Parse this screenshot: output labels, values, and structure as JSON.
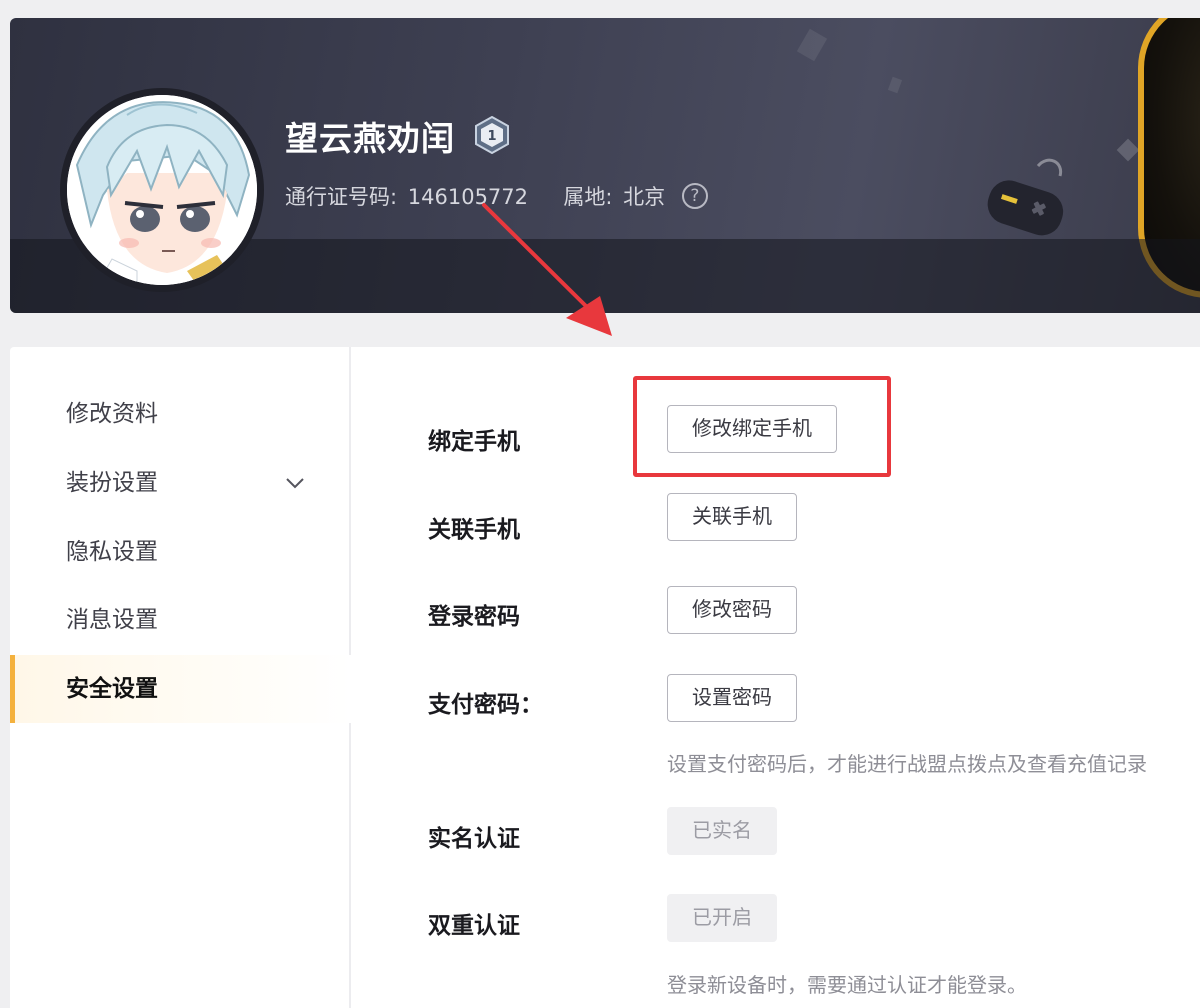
{
  "profile": {
    "username": "望云燕劝闰",
    "level": "1",
    "pass_id_label": "通行证号码:",
    "pass_id_value": "146105772",
    "location_label": "属地:",
    "location_value": "北京",
    "help_glyph": "?"
  },
  "sidebar": {
    "items": [
      {
        "label": "修改资料",
        "active": false
      },
      {
        "label": "装扮设置",
        "active": false,
        "has_chevron": true
      },
      {
        "label": "隐私设置",
        "active": false
      },
      {
        "label": "消息设置",
        "active": false
      },
      {
        "label": "安全设置",
        "active": true
      }
    ]
  },
  "security": {
    "rows": [
      {
        "label": "绑定手机",
        "button": "修改绑定手机",
        "disabled": false
      },
      {
        "label": "关联手机",
        "button": "关联手机",
        "disabled": false
      },
      {
        "label": "登录密码",
        "button": "修改密码",
        "disabled": false
      },
      {
        "label": "支付密码：",
        "button": "设置密码",
        "disabled": false,
        "hint": "设置支付密码后，才能进行战盟点拨点及查看充值记录"
      },
      {
        "label": "实名认证",
        "button": "已实名",
        "disabled": true
      },
      {
        "label": "双重认证",
        "button": "已开启",
        "disabled": true,
        "hint": "登录新设备时，需要通过认证才能登录。"
      }
    ]
  },
  "colors": {
    "accent": "#f4b13d",
    "annotation": "#e8383d",
    "banner": "#3e4052"
  },
  "icons": {
    "level_badge": "shield-level-icon",
    "help": "help-circle-icon",
    "chevron": "chevron-down-icon"
  }
}
